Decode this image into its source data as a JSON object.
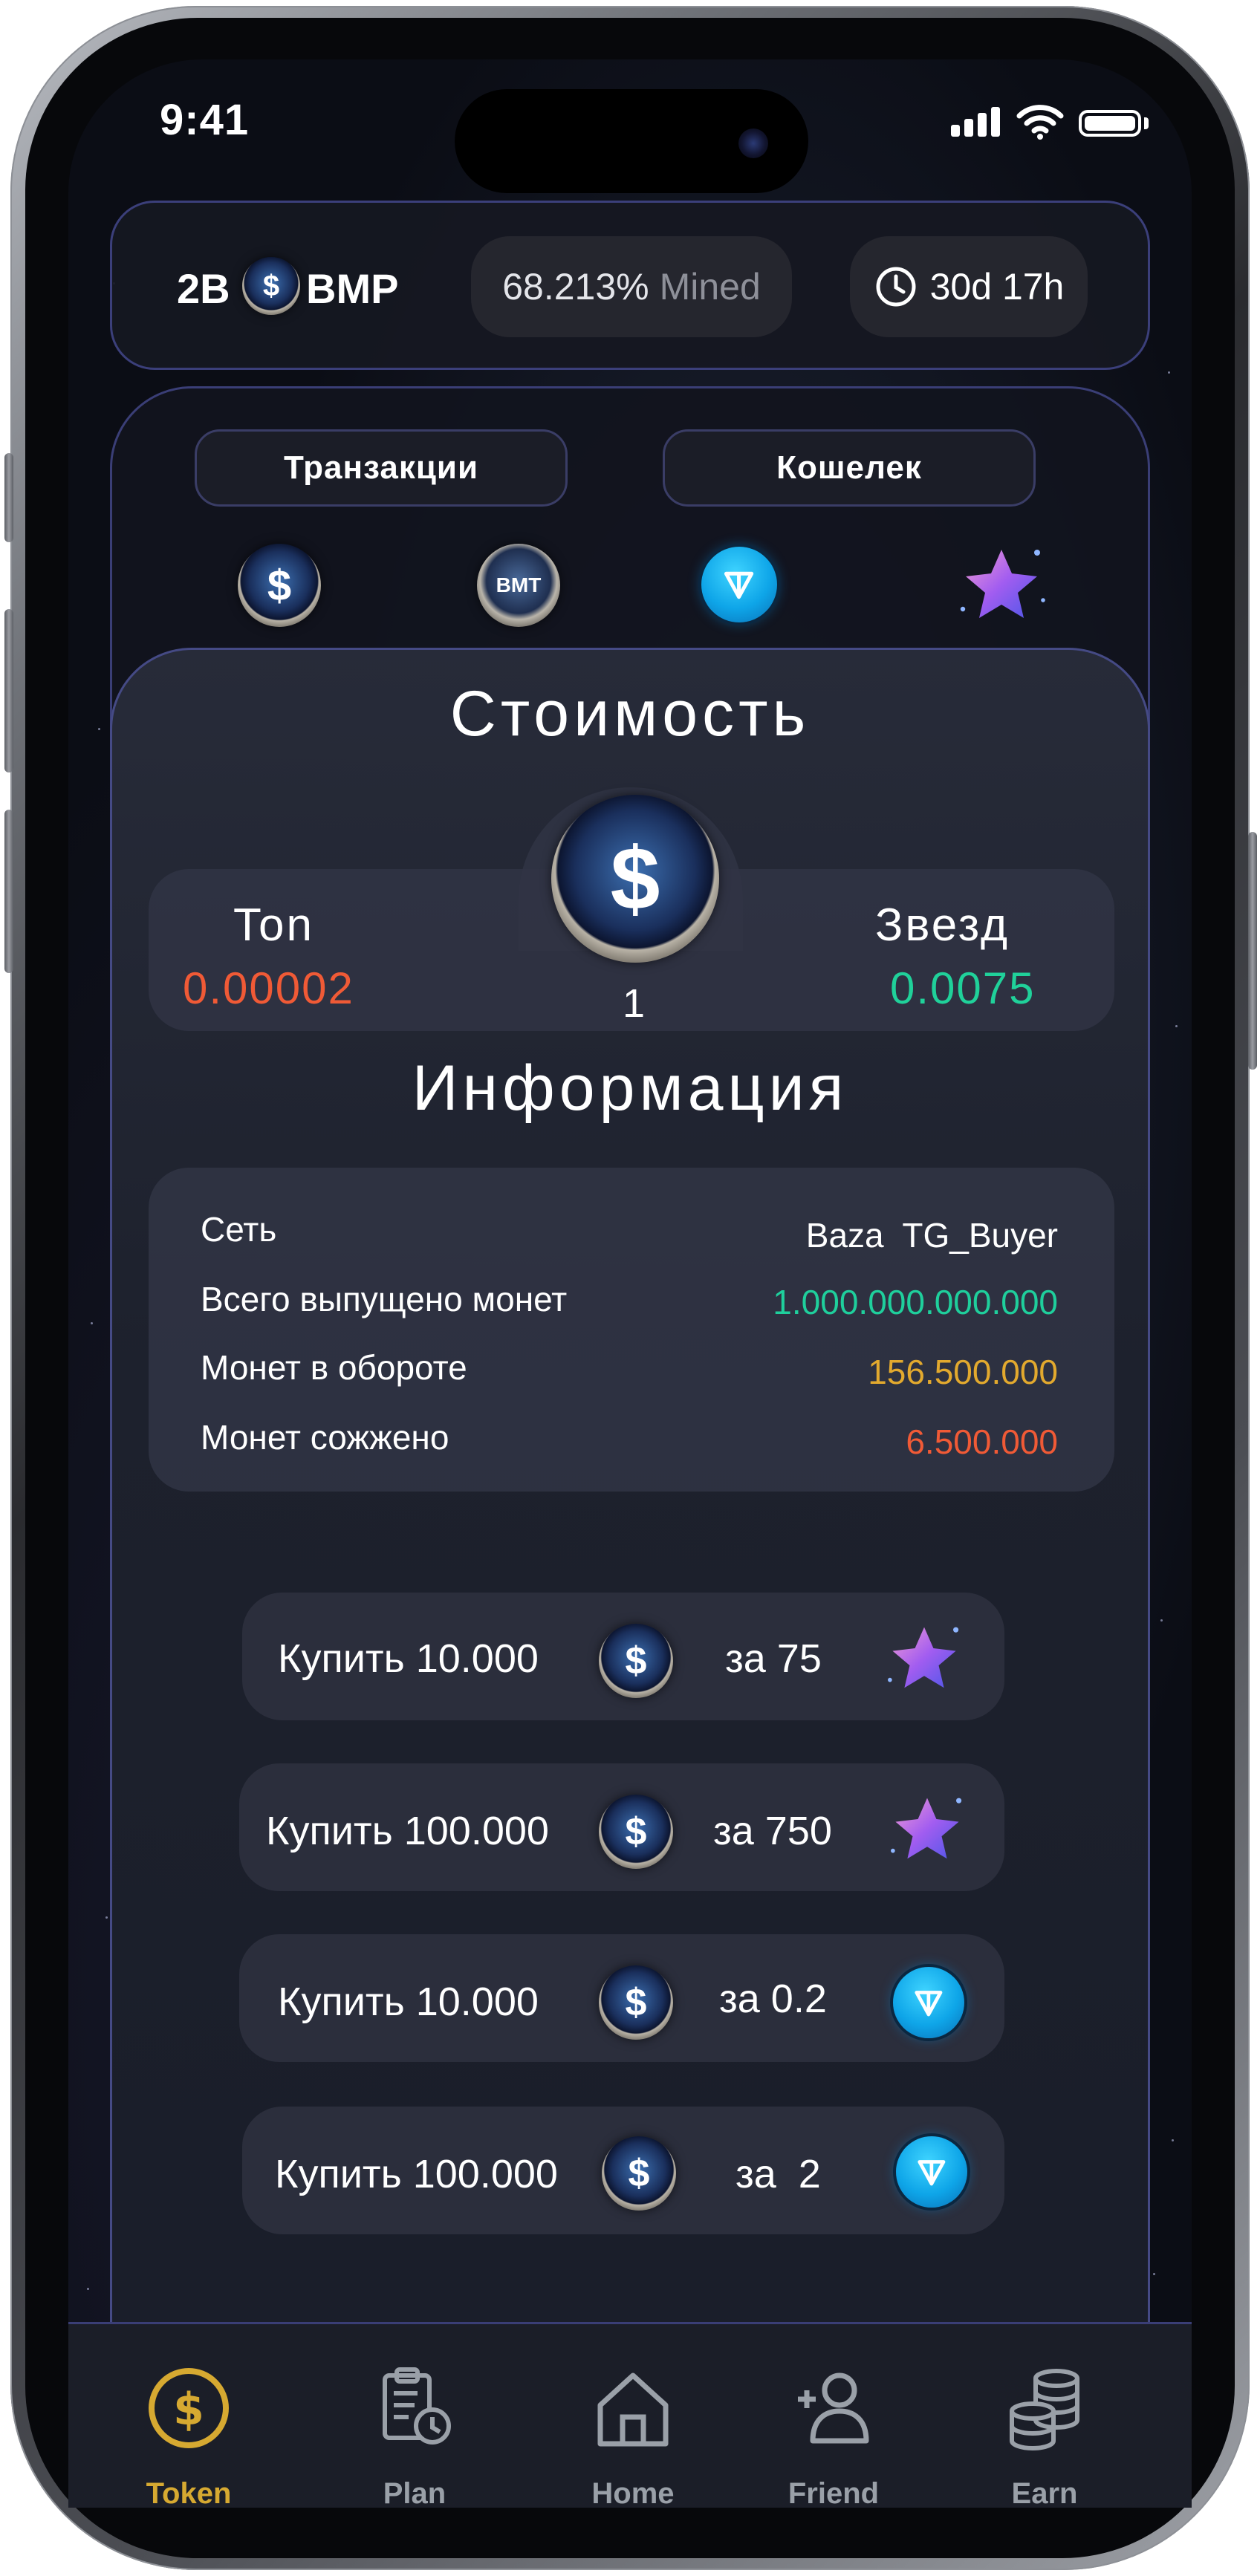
{
  "status": {
    "time": "9:41"
  },
  "topbar": {
    "amount": "2B",
    "ticker": "BMP",
    "mined_value": "68.213%",
    "mined_label": "Mined",
    "timer": "30d 17h"
  },
  "tabs": {
    "transactions": "Транзакции",
    "wallet": "Кошелек"
  },
  "currency_icons": [
    "dollar-coin-icon",
    "bmp-coin-icon",
    "ton-icon",
    "star-icon"
  ],
  "price": {
    "title": "Стоимость",
    "ton_label": "Ton",
    "ton_value": "0.00002",
    "coin_amount": "1",
    "stars_label": "Звезд",
    "stars_value": "0.0075"
  },
  "info": {
    "title": "Информация",
    "rows": [
      {
        "label": "Сеть",
        "value": "Baza  TG_Buyer"
      },
      {
        "label": "Всего выпущено монет",
        "value": "1.000.000.000.000"
      },
      {
        "label": "Монет в обороте",
        "value": "156.500.000"
      },
      {
        "label": "Монет сожжено",
        "value": "6.500.000"
      }
    ]
  },
  "buy_options": [
    {
      "label": "Купить 10.000",
      "price": "за 75",
      "currency": "star-icon"
    },
    {
      "label": "Купить 100.000",
      "price": "за 750",
      "currency": "star-icon"
    },
    {
      "label": "Купить 10.000",
      "price": "за 0.2",
      "currency": "ton-icon"
    },
    {
      "label": "Купить 100.000",
      "price": "за  2",
      "currency": "ton-icon"
    }
  ],
  "nav": {
    "items": [
      {
        "label": "Token",
        "icon": "dollar-circle-icon",
        "active": true
      },
      {
        "label": "Plan",
        "icon": "clipboard-clock-icon",
        "active": false
      },
      {
        "label": "Home",
        "icon": "home-icon",
        "active": false
      },
      {
        "label": "Friend",
        "icon": "add-user-icon",
        "active": false
      },
      {
        "label": "Earn",
        "icon": "coin-stack-icon",
        "active": false
      }
    ]
  },
  "colors": {
    "accent_gold": "#d6a931",
    "ton_value": "#f05a36",
    "stars_value": "#20d19a",
    "total_supply": "#1fcf9c",
    "circulating": "#e2a92e",
    "burned": "#f05a36"
  }
}
